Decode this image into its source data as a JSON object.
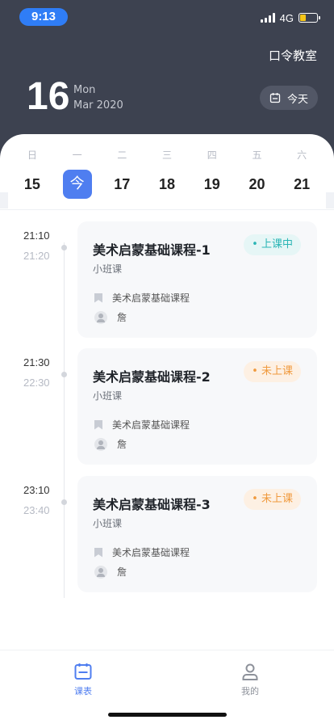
{
  "status_bar": {
    "time": "9:13",
    "network": "4G",
    "battery_level": 0.35
  },
  "header": {
    "class_code_label": "口令教室",
    "day": "16",
    "weekday": "Mon",
    "month_year": "Mar 2020",
    "today_button": "今天"
  },
  "week": [
    {
      "label": "日",
      "date": "15"
    },
    {
      "label": "一",
      "date": "今",
      "active": true
    },
    {
      "label": "二",
      "date": "17"
    },
    {
      "label": "三",
      "date": "18"
    },
    {
      "label": "四",
      "date": "19"
    },
    {
      "label": "五",
      "date": "20"
    },
    {
      "label": "六",
      "date": "21"
    }
  ],
  "lessons": [
    {
      "start": "21:10",
      "end": "21:20",
      "title": "美术启蒙基础课程-1",
      "type": "小班课",
      "status": "上课中",
      "course": "美术启蒙基础课程",
      "teacher": "詹"
    },
    {
      "start": "21:30",
      "end": "22:30",
      "title": "美术启蒙基础课程-2",
      "type": "小班课",
      "status": "未上课",
      "course": "美术启蒙基础课程",
      "teacher": "詹"
    },
    {
      "start": "23:10",
      "end": "23:40",
      "title": "美术启蒙基础课程-3",
      "type": "小班课",
      "status": "未上课",
      "course": "美术启蒙基础课程",
      "teacher": "詹"
    }
  ],
  "tabbar": {
    "schedule": "课表",
    "mine": "我的"
  },
  "colors": {
    "header_bg": "#3d4250",
    "accent": "#4f7ef0",
    "live": "#2ab5b5",
    "pending": "#f09a3e"
  }
}
